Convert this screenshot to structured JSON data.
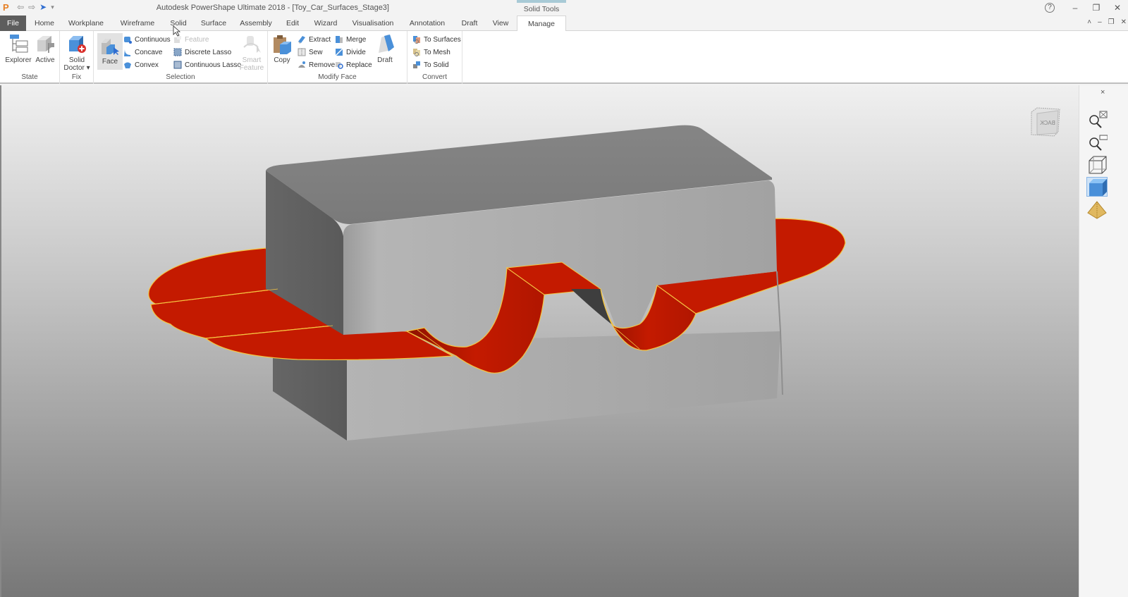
{
  "titlebar": {
    "app_logo": "P",
    "title": "Autodesk PowerShape Ultimate 2018 - [Toy_Car_Surfaces_Stage3]",
    "context_tab_group": "Solid Tools",
    "qat_icons": [
      "undo-icon",
      "redo-icon",
      "select-pointer-icon",
      "customize-qat-icon"
    ],
    "help": "?",
    "minimize": "–",
    "restore": "❐",
    "close": "✕"
  },
  "tabs": [
    {
      "label": "File"
    },
    {
      "label": "Home"
    },
    {
      "label": "Workplane"
    },
    {
      "label": "Wireframe"
    },
    {
      "label": "Solid"
    },
    {
      "label": "Surface"
    },
    {
      "label": "Assembly"
    },
    {
      "label": "Edit"
    },
    {
      "label": "Wizard"
    },
    {
      "label": "Visualisation"
    },
    {
      "label": "Annotation"
    },
    {
      "label": "Draft"
    },
    {
      "label": "View"
    },
    {
      "label": "Manage"
    }
  ],
  "active_tab": "Manage",
  "doc_controls": {
    "collapse": "˄",
    "minimize": "–",
    "restore": "❐",
    "close": "✕"
  },
  "ribbon": {
    "groups": {
      "state": {
        "label": "State",
        "explorer": "Explorer",
        "active": "Active"
      },
      "fix": {
        "label": "Fix",
        "solid_doctor": "Solid Doctor ▾",
        "solid_doctor_line1": "Solid",
        "solid_doctor_line2": "Doctor ▾"
      },
      "selection": {
        "label": "Selection",
        "face": "Face",
        "continuous": "Continuous",
        "concave": "Concave",
        "convex": "Convex",
        "feature": "Feature",
        "discrete_lasso": "Discrete Lasso",
        "continuous_lasso": "Continuous Lasso",
        "smart_feature_line1": "Smart",
        "smart_feature_line2": "Feature"
      },
      "modify_face": {
        "label": "Modify Face",
        "copy": "Copy",
        "extract": "Extract",
        "sew": "Sew",
        "remove": "Remove",
        "merge": "Merge",
        "divide": "Divide",
        "replace": "Replace",
        "draft": "Draft"
      },
      "convert": {
        "label": "Convert",
        "to_surfaces": "To Surfaces",
        "to_mesh": "To Mesh",
        "to_solid": "To Solid"
      }
    }
  },
  "viewport": {
    "viewcube_face": "BACK",
    "model_colors": {
      "solid": "#a4a4a4",
      "selected_face": "#c41a00",
      "edge_highlight": "#f5c542"
    }
  },
  "right_panel": {
    "close": "×",
    "tools": [
      "zoom-extents-icon",
      "zoom-box-icon",
      "wireframe-view-icon",
      "shaded-view-icon",
      "pyramid-view-icon"
    ]
  }
}
